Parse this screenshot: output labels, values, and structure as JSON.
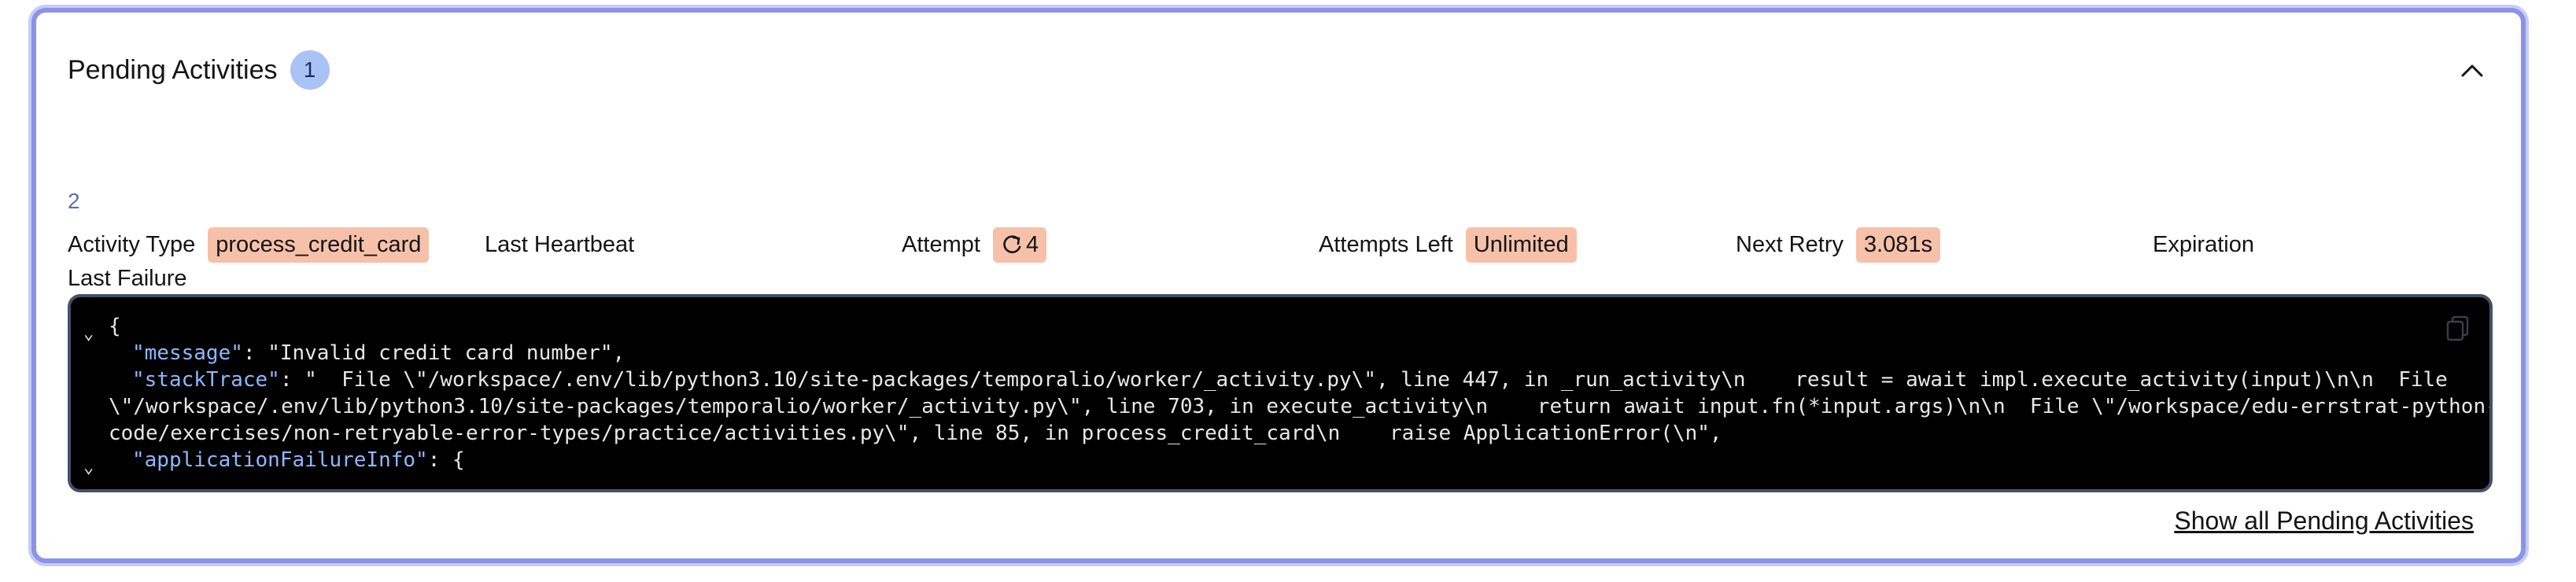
{
  "header": {
    "title": "Pending Activities",
    "count": "1"
  },
  "activity": {
    "index": "2",
    "fields": {
      "activity_type_label": "Activity Type",
      "activity_type_value": "process_credit_card",
      "last_heartbeat_label": "Last Heartbeat",
      "attempt_label": "Attempt",
      "attempt_value": "4",
      "attempts_left_label": "Attempts Left",
      "attempts_left_value": "Unlimited",
      "next_retry_label": "Next Retry",
      "next_retry_value": "3.081s",
      "expiration_label": "Expiration"
    },
    "last_failure_label": "Last Failure",
    "code": {
      "open_brace": "{",
      "message_key": "\"message\"",
      "message_rest": ": \"Invalid credit card number\",",
      "stack_key": "\"stackTrace\"",
      "stack_line1": ": \"  File \\\"/workspace/.env/lib/python3.10/site-packages/temporalio/worker/_activity.py\\\", line 447, in _run_activity\\n    result = await impl.execute_activity(input)\\n\\n  File",
      "stack_line2": "\\\"/workspace/.env/lib/python3.10/site-packages/temporalio/worker/_activity.py\\\", line 703, in execute_activity\\n    return await input.fn(*input.args)\\n\\n  File \\\"/workspace/edu-errstrat-python-",
      "stack_line3": "code/exercises/non-retryable-error-types/practice/activities.py\\\", line 85, in process_credit_card\\n    raise ApplicationError(\\n\",",
      "app_failure_key": "\"applicationFailureInfo\"",
      "app_failure_rest": ": {"
    }
  },
  "footer": {
    "show_all_label": "Show all Pending Activities"
  },
  "icons": {
    "collapse": "chevron-up-icon",
    "retry": "retry-icon",
    "copy": "copy-icon",
    "fold": "fold-chevron-icon"
  },
  "colors": {
    "card_border": "#8a93e8",
    "pill_bg": "#f7c1a9",
    "badge_bg": "#a9c3f5",
    "code_bg": "#000000",
    "json_key": "#8fb8ff"
  }
}
